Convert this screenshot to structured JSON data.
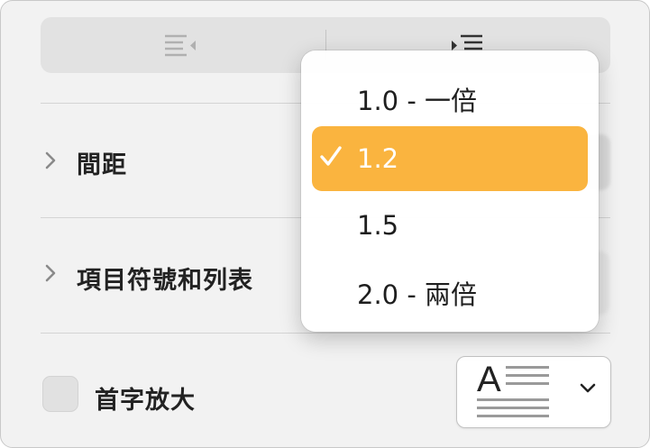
{
  "indent_controls": {
    "decrease_icon": "decrease-indent-icon",
    "increase_icon": "increase-indent-icon"
  },
  "sections": {
    "spacing_label": "間距",
    "bullets_label": "項目符號和列表"
  },
  "drop_cap": {
    "label": "首字放大",
    "checked": false,
    "preview_letter": "A",
    "chevron_icon": "chevron-down-icon"
  },
  "line_spacing_menu": {
    "options": [
      {
        "label": "1.0 - 一倍",
        "selected": false
      },
      {
        "label": "1.2",
        "selected": true
      },
      {
        "label": "1.5",
        "selected": false
      },
      {
        "label": "2.0 - 兩倍",
        "selected": false
      }
    ],
    "check_icon": "checkmark-icon"
  },
  "colors": {
    "selected_highlight": "#fab43f",
    "panel_background": "#f2f2f2",
    "control_background": "#e2e2e2"
  }
}
